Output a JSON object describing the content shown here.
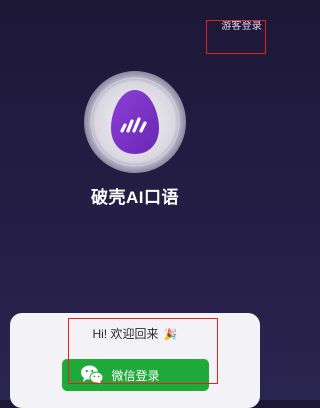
{
  "header": {
    "guest_login": "游客登录"
  },
  "app": {
    "name": "破壳AI口语",
    "logo_icon": "egg-logo-icon",
    "accent_color": "#7a34c2"
  },
  "login": {
    "welcome_text": "Hi! 欢迎回来",
    "welcome_emoji": "🎉",
    "wechat_button_label": "微信登录",
    "wechat_icon": "wechat-icon",
    "button_color": "#1fa93a"
  }
}
